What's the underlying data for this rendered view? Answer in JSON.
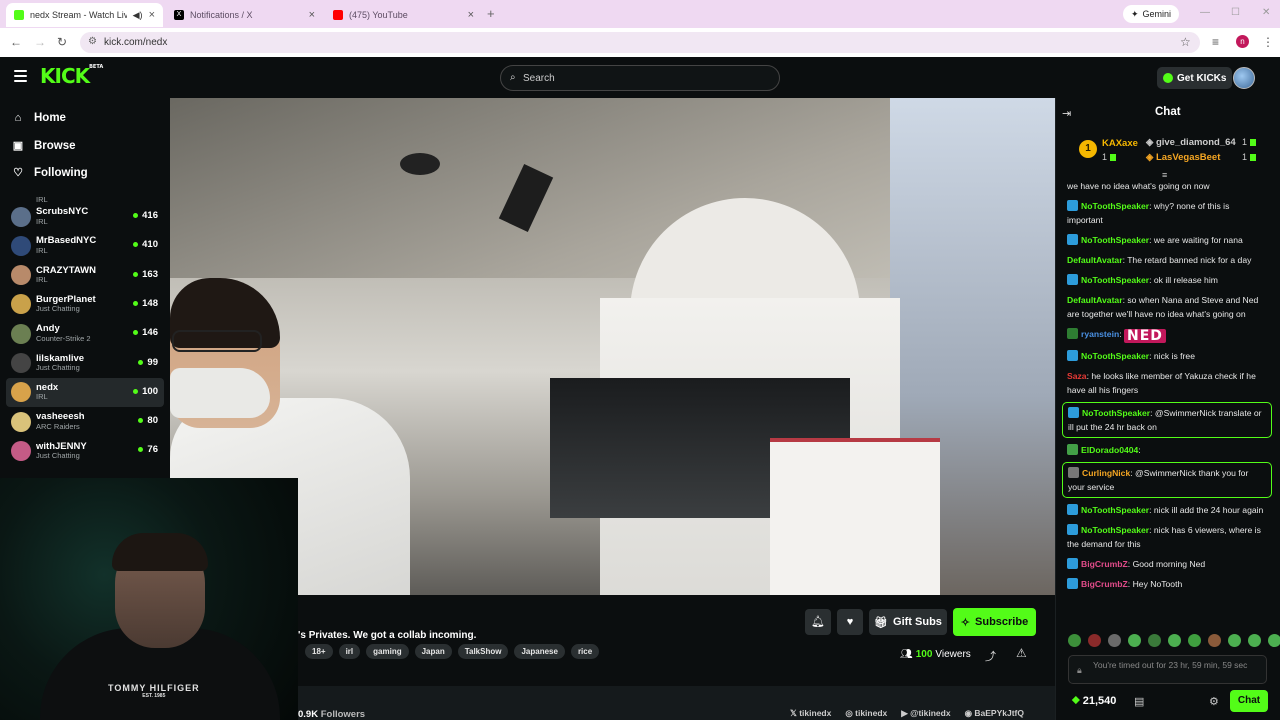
{
  "browser": {
    "tabs": [
      {
        "label": "nedx Stream - Watch Live o",
        "favicon_color": "#53fc18",
        "active": true
      },
      {
        "label": "Notifications / X",
        "favicon_color": "#000000",
        "active": false
      },
      {
        "label": "(475) YouTube",
        "favicon_color": "#ff0000",
        "active": false
      }
    ],
    "gemini_label": "Gemini",
    "url": "kick.com/nedx",
    "profile_initial": "n"
  },
  "header": {
    "logo": "KICK",
    "logo_badge": "BETA",
    "search_placeholder": "Search",
    "get_kicks_label": "Get KICKs"
  },
  "sidebar": {
    "nav": [
      {
        "label": "Home",
        "icon": "home-icon"
      },
      {
        "label": "Browse",
        "icon": "browse-icon"
      },
      {
        "label": "Following",
        "icon": "heart-icon"
      }
    ],
    "partial_category": "IRL",
    "channels": [
      {
        "name": "ScrubsNYC",
        "category": "IRL",
        "viewers": "416",
        "color": "#5b6f8a"
      },
      {
        "name": "MrBasedNYC",
        "category": "IRL",
        "viewers": "410",
        "color": "#2f4a78"
      },
      {
        "name": "CRAZYTAWN",
        "category": "IRL",
        "viewers": "163",
        "color": "#b88a6a"
      },
      {
        "name": "BurgerPlanet",
        "category": "Just Chatting",
        "viewers": "148",
        "color": "#c9a14a"
      },
      {
        "name": "Andy",
        "category": "Counter-Strike 2",
        "viewers": "146",
        "color": "#6b7f52"
      },
      {
        "name": "lilskamlive",
        "category": "Just Chatting",
        "viewers": "99",
        "color": "#444444"
      },
      {
        "name": "nedx",
        "category": "IRL",
        "viewers": "100",
        "color": "#d8a24a",
        "active": true
      },
      {
        "name": "vasheeesh",
        "category": "ARC Raiders",
        "viewers": "80",
        "color": "#d9c27a"
      },
      {
        "name": "withJENNY",
        "category": "Just Chatting",
        "viewers": "76",
        "color": "#c45b86"
      }
    ]
  },
  "stream": {
    "title": "'s Privates. We got a collab incoming.",
    "tags": [
      "18+",
      "irl",
      "gaming",
      "Japan",
      "TalkShow",
      "Japanese",
      "rice"
    ],
    "gift_subs_label": "Gift Subs",
    "subscribe_label": "Subscribe",
    "viewers_count": "100",
    "viewers_label": "Viewers",
    "followers_count": "0.9K",
    "followers_label": "Followers",
    "socials": [
      "tikinedx",
      "tikinedx",
      "@tikinedx",
      "BaEPYkJtfQ"
    ],
    "webcam_shirt_text": "TOMMY HILFIGER",
    "webcam_shirt_sub": "EST. 1985"
  },
  "chat": {
    "title": "Chat",
    "leaderboard": {
      "rank": "1",
      "first": {
        "name": "KAXaxe",
        "count": "1"
      },
      "second": {
        "name": "give_diamond_64",
        "count": "1"
      },
      "third": {
        "name": "LasVegasBeet",
        "count": "1"
      }
    },
    "messages": [
      {
        "user": "",
        "color": "#53fc18",
        "text": "we have no idea what's going on now",
        "badge": ""
      },
      {
        "user": "NoToothSpeaker",
        "color": "#53fc18",
        "text": "why? none of this is important",
        "badge": "#2d9cdb"
      },
      {
        "user": "NoToothSpeaker",
        "color": "#53fc18",
        "text": "we are waiting for nana",
        "badge": "#2d9cdb"
      },
      {
        "user": "DefaultAvatar",
        "color": "#53fc18",
        "text": "The retard banned nick for a day",
        "badge": ""
      },
      {
        "user": "NoToothSpeaker",
        "color": "#53fc18",
        "text": "ok ill release him",
        "badge": "#2d9cdb"
      },
      {
        "user": "DefaultAvatar",
        "color": "#53fc18",
        "text": "so when Nana and Steve and Ned are together we'll have no idea what's going on",
        "badge": ""
      },
      {
        "user": "ryanstein",
        "color": "#4a90e2",
        "text": "",
        "badge": "#2e7d32",
        "emote": "NED"
      },
      {
        "user": "NoToothSpeaker",
        "color": "#53fc18",
        "text": "nick is free",
        "badge": "#2d9cdb"
      },
      {
        "user": "Saza",
        "color": "#e53935",
        "text": "he looks like member of Yakuza check if he have all his fingers",
        "badge": ""
      },
      {
        "user": "NoToothSpeaker",
        "color": "#53fc18",
        "text": "@SwimmerNick translate or ill put the 24 hr back on",
        "badge": "#2d9cdb",
        "highlight": true
      },
      {
        "user": "ElDorado0404",
        "color": "#53fc18",
        "text": "",
        "badge": "#43a047"
      },
      {
        "user": "CurlingNick",
        "color": "#f5a623",
        "text": "@SwimmerNick thank you for your service",
        "badge": "#777777",
        "highlight": true
      },
      {
        "user": "NoToothSpeaker",
        "color": "#53fc18",
        "text": "nick ill add the 24 hour again",
        "badge": "#2d9cdb"
      },
      {
        "user": "NoToothSpeaker",
        "color": "#53fc18",
        "text": "nick has 6 viewers, where is the demand for this",
        "badge": "#2d9cdb"
      },
      {
        "user": "BigCrumbZ",
        "color": "#e24c8a",
        "text": "Good morning Ned",
        "badge": "#2d9cdb"
      },
      {
        "user": "BigCrumbZ",
        "color": "#e24c8a",
        "text": "Hey NoTooth",
        "badge": "#2d9cdb"
      }
    ],
    "timeout_text": "You're timed out for 23 hr, 59 min, 59 sec",
    "kicks_balance": "21,540",
    "chat_button": "Chat"
  }
}
